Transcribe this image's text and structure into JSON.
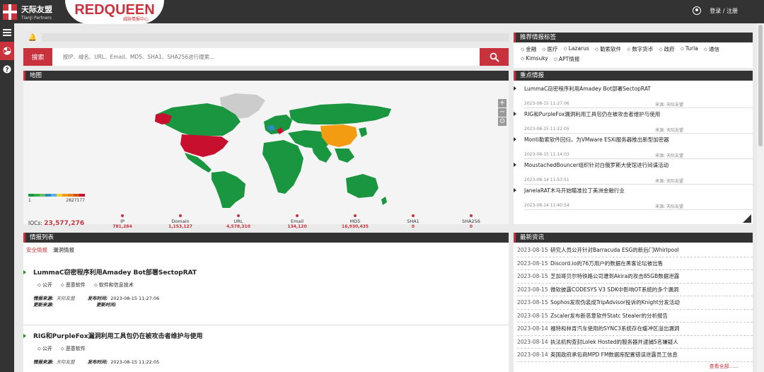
{
  "header": {
    "partner_name": "天际友盟",
    "partner_sub": "TianJi Partners",
    "brand_big": "REDQUEEN",
    "brand_small": "威胁情报中心",
    "login": "登录 / 注册"
  },
  "search": {
    "button": "搜索",
    "placeholder": "按IP、域名、URL、Email、MD5、SHA1、SHA256进行搜索..."
  },
  "map": {
    "title": "地图",
    "legend_min": "1",
    "legend_max": "2827177",
    "iocs_label": "IOCs:",
    "iocs_value": "23,577,276",
    "stats": [
      {
        "name": "IP",
        "value": "781,284"
      },
      {
        "name": "Domain",
        "value": "1,153,127"
      },
      {
        "name": "URL",
        "value": "4,578,310"
      },
      {
        "name": "Email",
        "value": "134,120"
      },
      {
        "name": "MD5",
        "value": "16,930,435"
      },
      {
        "name": "SHA1",
        "value": "0"
      },
      {
        "name": "SHA256",
        "value": "0"
      }
    ]
  },
  "tags": {
    "title": "推荐情报标签",
    "items": [
      "金融",
      "医疗",
      "Lazarus",
      "勒索软件",
      "数字货币",
      "政府",
      "Turla",
      "通信",
      "Kimsuky",
      "APT情报"
    ]
  },
  "key": {
    "title": "重点情报",
    "items": [
      {
        "title": "LummaC窃密程序利用Amadey Bot部署SectopRAT",
        "date": "2023-08-15 11:27:06",
        "source": "来源: 天际友盟"
      },
      {
        "title": "RIG和PurpleFox漏洞利用工具包仍在被攻击者维护与使用",
        "date": "2023-08-15 11:22:05",
        "source": "来源: 天际友盟"
      },
      {
        "title": "Monti勒索软件回归，为VMware ESXi服务器推出新型加密器",
        "date": "2023-08-15 11:14:03",
        "source": "来源: 天际友盟"
      },
      {
        "title": "MoustachedBouncer组织针对白俄罗斯大使馆进行间谍活动",
        "date": "2023-08-14 11:53:51",
        "source": "来源: 天际友盟"
      },
      {
        "title": "JanelaRAT木马开始瞄准拉丁美洲金融行业",
        "date": "2023-08-14 11:40:54",
        "source": "来源: 天际友盟"
      }
    ]
  },
  "list": {
    "title": "情报列表",
    "tab_security": "安全情报",
    "tab_vuln": "漏洞情报",
    "labels": {
      "source": "情报来源:",
      "publish": "发布时间:",
      "update_src": "更新来源:",
      "update_time": "更新时间:"
    },
    "items": [
      {
        "title": "LummaC窃密程序利用Amadey Bot部署SectopRAT",
        "tags": [
          "公开",
          "恶意软件",
          "软件和信息技术"
        ],
        "source": "天际友盟",
        "time": "2023-08-15 11:27:06"
      },
      {
        "title": "RIG和PurpleFox漏洞利用工具包仍在被攻击者维护与使用",
        "tags": [
          "公开",
          "恶意软件"
        ],
        "source": "天际友盟",
        "time": "2023-08-15 11:22:05"
      }
    ]
  },
  "news": {
    "title": "最新资讯",
    "more": "查看全部......",
    "items": [
      {
        "date": "2023-08-15",
        "text": "研究人员公开针对Barracuda ESG的新后门Whirlpool"
      },
      {
        "date": "2023-08-15",
        "text": "Discord.io的76万用户的数据在黑客论坛被出售"
      },
      {
        "date": "2023-08-15",
        "text": "芝加哥贝尔特铁路公司遭到Akira的攻击85GB数据泄露"
      },
      {
        "date": "2023-08-15",
        "text": "微软披露CODESYS V3 SDK中影响OT系统的多个漏洞"
      },
      {
        "date": "2023-08-15",
        "text": "Sophos发现伪装成TripAdvisor投诉的Knight分发活动"
      },
      {
        "date": "2023-08-15",
        "text": "Zscaler发布新恶意软件Statc Stealer的分析报告"
      },
      {
        "date": "2023-08-14",
        "text": "福特和林肯汽车使用的SYNC3系统存在缓冲区溢出漏洞"
      },
      {
        "date": "2023-08-14",
        "text": "执法机构查封Lolek Hosted的服务器并逮捕5名嫌疑人"
      },
      {
        "date": "2023-08-14",
        "text": "英国政府承包商MPD FM数据库配置错误泄露员工信息"
      }
    ]
  },
  "colors": {
    "accent": "#c8323c",
    "dark": "#333333",
    "map_green": "#1a9641",
    "map_red": "#c8102e",
    "map_orange": "#f39c12",
    "map_gray": "#cccccc"
  }
}
